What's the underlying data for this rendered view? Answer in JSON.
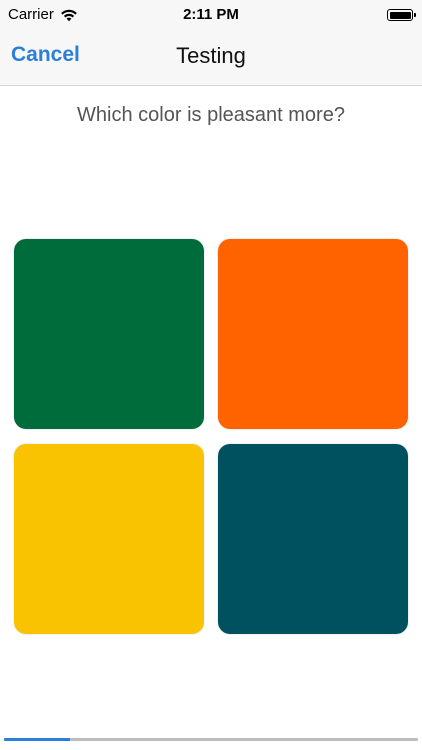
{
  "status_bar": {
    "carrier": "Carrier",
    "time": "2:11 PM",
    "wifi_icon": "wifi-icon",
    "battery_icon": "battery-icon"
  },
  "nav": {
    "cancel_label": "Cancel",
    "title": "Testing"
  },
  "question": "Which color is pleasant more?",
  "choices": [
    {
      "color": "#006b3b"
    },
    {
      "color": "#ff6300"
    },
    {
      "color": "#f9c301"
    },
    {
      "color": "#00515f"
    }
  ],
  "progress": {
    "fraction": 0.16
  },
  "colors": {
    "accent": "#2a7fd8"
  }
}
